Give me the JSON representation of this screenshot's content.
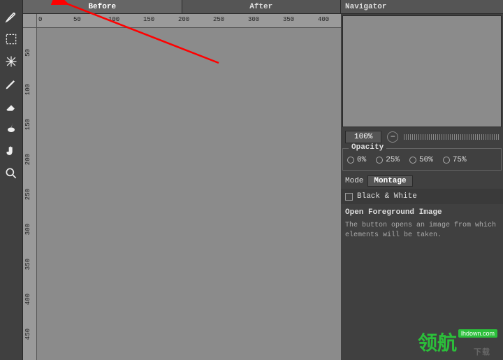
{
  "toolbar": {
    "tools": [
      "brush",
      "marquee",
      "transform",
      "pencil",
      "eraser",
      "smudge",
      "hand",
      "zoom"
    ]
  },
  "tabs": {
    "before": "Before",
    "after": "After"
  },
  "ruler": {
    "hticks": [
      "0",
      "50",
      "100",
      "150",
      "200",
      "250",
      "300",
      "350",
      "400"
    ],
    "vticks": [
      "50",
      "100",
      "150",
      "200",
      "250",
      "300",
      "350",
      "400",
      "450"
    ]
  },
  "navigator": {
    "title": "Navigator",
    "zoom": "100%"
  },
  "opacity": {
    "title": "Opacity",
    "opts": [
      "0%",
      "25%",
      "50%",
      "75%"
    ]
  },
  "mode": {
    "label": "Mode",
    "value": "Montage"
  },
  "bw": {
    "label": "Black & White"
  },
  "fg": {
    "title": "Open Foreground Image",
    "desc": "The button opens an image from which elements will be taken."
  },
  "watermark": {
    "text": "领航",
    "badge": "lhdown.com",
    "sub": "下载"
  }
}
